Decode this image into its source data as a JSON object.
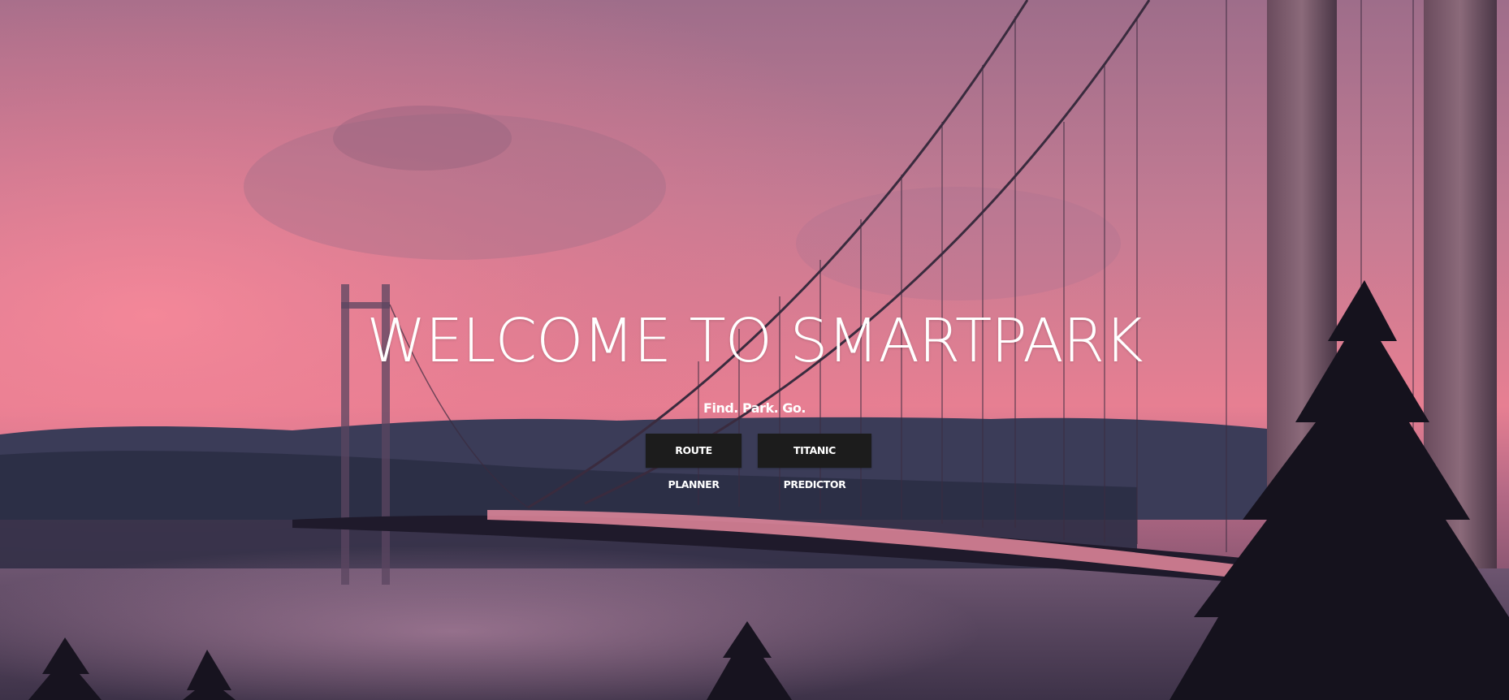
{
  "hero": {
    "title": "WELCOME TO SMARTPARK",
    "tagline": "Find. Park. Go.",
    "background": "suspension-bridge-sunset-photo"
  },
  "buttons": {
    "route_planner": "ROUTE PLANNER",
    "titanic_predictor": "TITANIC PREDICTOR"
  },
  "colors": {
    "button_bg": "#1c1c1c",
    "text": "#ffffff",
    "sky_top": "#b8728c",
    "sky_glow": "#e7798f"
  }
}
